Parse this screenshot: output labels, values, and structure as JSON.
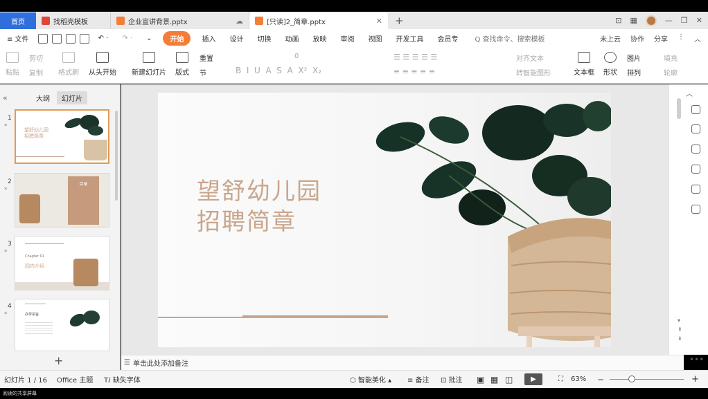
{
  "tabs": {
    "home": "首页",
    "tab1": "找稻壳模板",
    "tab2": "企业宣讲背景.pptx",
    "tab3": "[只读]2_简章.pptx",
    "add": "+"
  },
  "menu": {
    "file": "≡ 文件",
    "start": "开始",
    "insert": "插入",
    "design": "设计",
    "transition": "切换",
    "animation": "动画",
    "slideshow": "放映",
    "review": "审阅",
    "view": "视图",
    "devtools": "开发工具",
    "member": "会员专",
    "search": "Q 查找命令、搜索模板",
    "cloud": "未上云",
    "collab": "协作",
    "share": "分享"
  },
  "ribbon": {
    "paste": "粘贴",
    "cut": "剪切",
    "copy": "复制",
    "format_painter": "格式刷",
    "from_start": "从头开始",
    "new_slide": "新建幻灯片",
    "layout": "版式",
    "reset": "重置",
    "section": "节",
    "font_size": "0",
    "align_text": "对齐文本",
    "to_smartart": "转智能图形",
    "textbox": "文本框",
    "shape": "形状",
    "picture": "图片",
    "arrange": "排列",
    "fill": "填充",
    "outline": "轮廓"
  },
  "left_panel": {
    "outline_tab": "大纲",
    "slides_tab": "幻灯片",
    "slides": [
      {
        "num": "1",
        "title": "望舒幼儿园\n招聘简章"
      },
      {
        "num": "2",
        "title": "目录"
      },
      {
        "num": "3",
        "title": "园内介绍",
        "chapter": "Chapter 01"
      },
      {
        "num": "4",
        "title": "办学宗旨"
      }
    ]
  },
  "slide": {
    "title_line1": "望舒幼儿园",
    "title_line2": "招聘简章"
  },
  "notes_placeholder": "单击此处添加备注",
  "status": {
    "slide_index": "幻灯片 1 / 16",
    "theme": "Office 主题",
    "missing_font": "缺失字体",
    "smart_beautify": "智能美化",
    "notes": "备注",
    "comments": "批注",
    "zoom": "63%"
  },
  "footer_caption": "阅读的共享屏幕",
  "colors": {
    "accent_orange": "#f47d3a",
    "home_tab_blue": "#2f6fdd",
    "title_tan": "#c9a68c"
  }
}
